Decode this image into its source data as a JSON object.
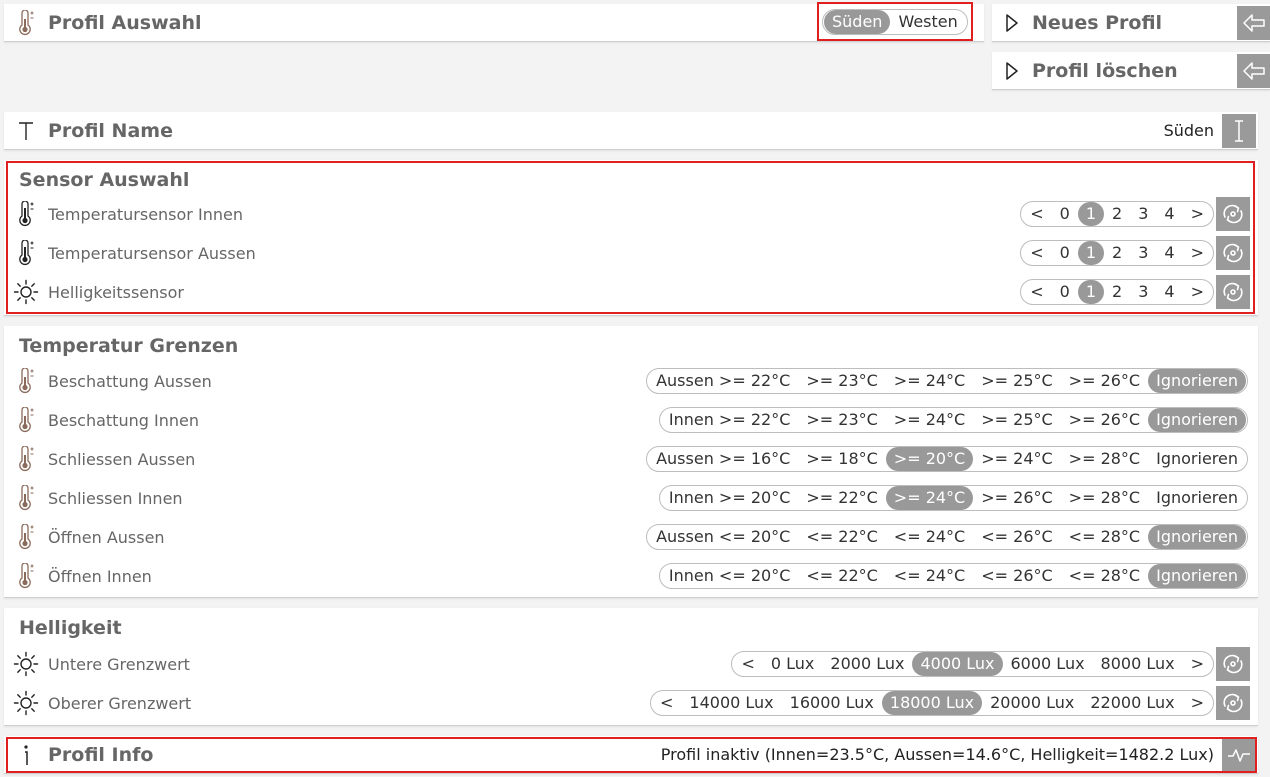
{
  "profil_auswahl": {
    "title": "Profil Auswahl",
    "options": [
      "Süden",
      "Westen"
    ],
    "selected": 0
  },
  "neues_profil": {
    "label": "Neues Profil"
  },
  "profil_loeschen": {
    "label": "Profil löschen"
  },
  "profil_name": {
    "title": "Profil Name",
    "value": "Süden"
  },
  "sensor_auswahl": {
    "title": "Sensor Auswahl",
    "rows": [
      {
        "label": "Temperatursensor Innen",
        "icon": "thermometer-icon",
        "options": [
          "<",
          "0",
          "1",
          "2",
          "3",
          "4",
          ">"
        ],
        "selected": 2
      },
      {
        "label": "Temperatursensor Aussen",
        "icon": "thermometer-icon",
        "options": [
          "<",
          "0",
          "1",
          "2",
          "3",
          "4",
          ">"
        ],
        "selected": 2
      },
      {
        "label": "Helligkeitssensor",
        "icon": "sun-icon",
        "options": [
          "<",
          "0",
          "1",
          "2",
          "3",
          "4",
          ">"
        ],
        "selected": 2
      }
    ]
  },
  "temperatur_grenzen": {
    "title": "Temperatur Grenzen",
    "rows": [
      {
        "label": "Beschattung Aussen",
        "options": [
          "Aussen >= 22°C",
          ">= 23°C",
          ">= 24°C",
          ">= 25°C",
          ">= 26°C",
          "Ignorieren"
        ],
        "selected": 5
      },
      {
        "label": "Beschattung Innen",
        "options": [
          "Innen >= 22°C",
          ">= 23°C",
          ">= 24°C",
          ">= 25°C",
          ">= 26°C",
          "Ignorieren"
        ],
        "selected": 5
      },
      {
        "label": "Schliessen Aussen",
        "options": [
          "Aussen >= 16°C",
          ">= 18°C",
          ">= 20°C",
          ">= 24°C",
          ">= 28°C",
          "Ignorieren"
        ],
        "selected": 2
      },
      {
        "label": "Schliessen Innen",
        "options": [
          "Innen >= 20°C",
          ">= 22°C",
          ">= 24°C",
          ">= 26°C",
          ">= 28°C",
          "Ignorieren"
        ],
        "selected": 2
      },
      {
        "label": "Öffnen Aussen",
        "options": [
          "Aussen <= 20°C",
          "<= 22°C",
          "<= 24°C",
          "<= 26°C",
          "<= 28°C",
          "Ignorieren"
        ],
        "selected": 5
      },
      {
        "label": "Öffnen Innen",
        "options": [
          "Innen <= 20°C",
          "<= 22°C",
          "<= 24°C",
          "<= 26°C",
          "<= 28°C",
          "Ignorieren"
        ],
        "selected": 5
      }
    ]
  },
  "helligkeit": {
    "title": "Helligkeit",
    "rows": [
      {
        "label": "Untere Grenzwert",
        "options": [
          "<",
          "0 Lux",
          "2000 Lux",
          "4000 Lux",
          "6000 Lux",
          "8000 Lux",
          ">"
        ],
        "selected": 3
      },
      {
        "label": "Oberer Grenzwert",
        "options": [
          "<",
          "14000 Lux",
          "16000 Lux",
          "18000 Lux",
          "20000 Lux",
          "22000 Lux",
          ">"
        ],
        "selected": 3
      }
    ]
  },
  "profil_info": {
    "title": "Profil Info",
    "status": "Profil inaktiv (Innen=23.5°C, Aussen=14.6°C, Helligkeit=1482.2 Lux)"
  }
}
